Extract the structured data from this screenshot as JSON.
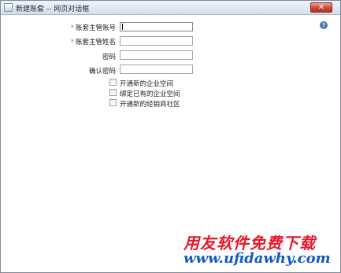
{
  "window": {
    "title": "新建账套 -- 网页对话框",
    "close_glyph": "✕",
    "help_glyph": "?"
  },
  "form": {
    "required_mark": "*",
    "fields": [
      {
        "label": "账套主管账号",
        "required": true,
        "value": ""
      },
      {
        "label": "账套主管姓名",
        "required": true,
        "value": ""
      },
      {
        "label": "密码",
        "required": false,
        "value": ""
      },
      {
        "label": "确认密码",
        "required": false,
        "value": ""
      }
    ],
    "options": [
      {
        "label": "开通新的企业空间",
        "checked": false
      },
      {
        "label": "绑定已有的企业空间",
        "checked": false
      },
      {
        "label": "开通新的经销商社区",
        "checked": false
      }
    ]
  },
  "watermark": {
    "brand": "用友软件免费下载",
    "url": "www.ufidawhy.com"
  }
}
